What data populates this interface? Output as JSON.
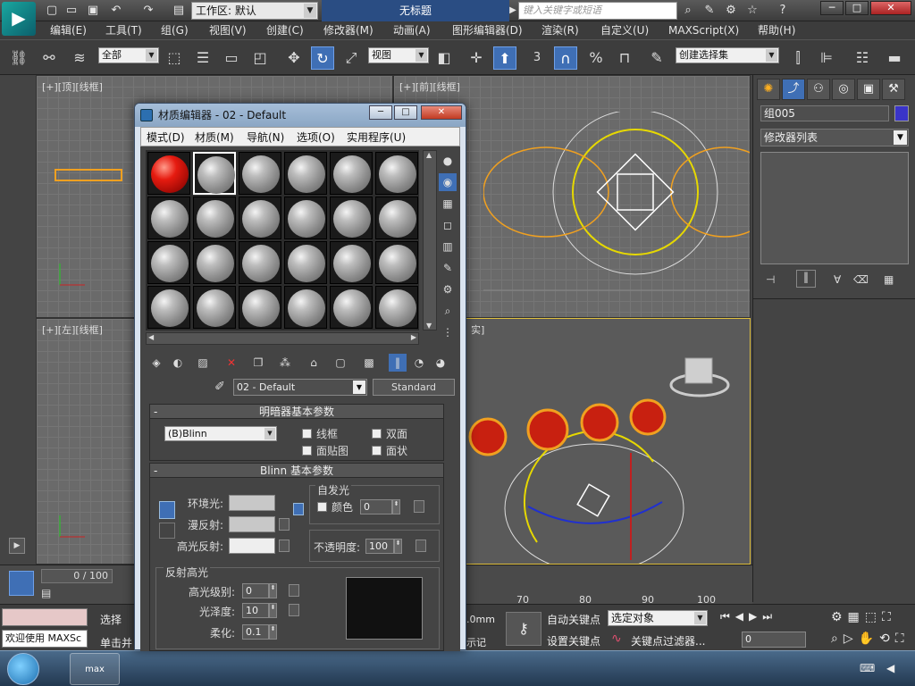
{
  "titlebar": {
    "workspace": "工作区: 默认",
    "doc_title": "无标题",
    "search_placeholder": "键入关键字或短语",
    "min": "─",
    "max": "□",
    "close": "✕"
  },
  "menu": [
    "编辑(E)",
    "工具(T)",
    "组(G)",
    "视图(V)",
    "创建(C)",
    "修改器(M)",
    "动画(A)",
    "图形编辑器(D)",
    "渲染(R)",
    "自定义(U)",
    "MAXScript(X)",
    "帮助(H)"
  ],
  "toolbar": {
    "selection_filter": "全部",
    "ref_coord": "视图",
    "snap_num": "3",
    "named_selection": "创建选择集"
  },
  "viewports": {
    "top": "[+][顶][线框]",
    "front": "[+][前][线框]",
    "left": "[+][左][线框]",
    "persp": "实]"
  },
  "command_panel": {
    "object_name": "组005",
    "modifier_list": "修改器列表",
    "object_color": "#3a34c8"
  },
  "material_editor": {
    "title": "材质编辑器 - 02 - Default",
    "menus": [
      "模式(D)",
      "材质(M)",
      "导航(N)",
      "选项(O)",
      "实用程序(U)"
    ],
    "material_name": "02 - Default",
    "material_type": "Standard",
    "shader_rollout": {
      "title": "明暗器基本参数",
      "shader": "(B)Blinn",
      "wire": "线框",
      "two_sided": "双面",
      "face_map": "面贴图",
      "faceted": "面状"
    },
    "blinn_rollout": {
      "title": "Blinn 基本参数",
      "self_illum": "自发光",
      "color": "颜色",
      "color_value": "0",
      "ambient": "环境光:",
      "diffuse": "漫反射:",
      "specular": "高光反射:",
      "opacity": "不透明度:",
      "opacity_value": "100"
    },
    "spec_rollout": {
      "title": "反射高光",
      "level": "高光级别:",
      "level_value": "0",
      "gloss": "光泽度:",
      "gloss_value": "10",
      "soften": "柔化:",
      "soften_value": "0.1"
    }
  },
  "timeline": {
    "frame": "0 / 100",
    "ticks": [
      "70",
      "80",
      "90",
      "100"
    ]
  },
  "status": {
    "welcome": "欢迎使用 MAXSc",
    "select": "选择",
    "click": "单击并",
    "units": ".0mm",
    "mark": "示记",
    "auto_key": "自动关键点",
    "set_key": "设置关键点",
    "selected_obj": "选定对象",
    "key_filter": "关键点过滤器...",
    "frame_field": "0"
  },
  "taskbar": {
    "app": "max"
  }
}
